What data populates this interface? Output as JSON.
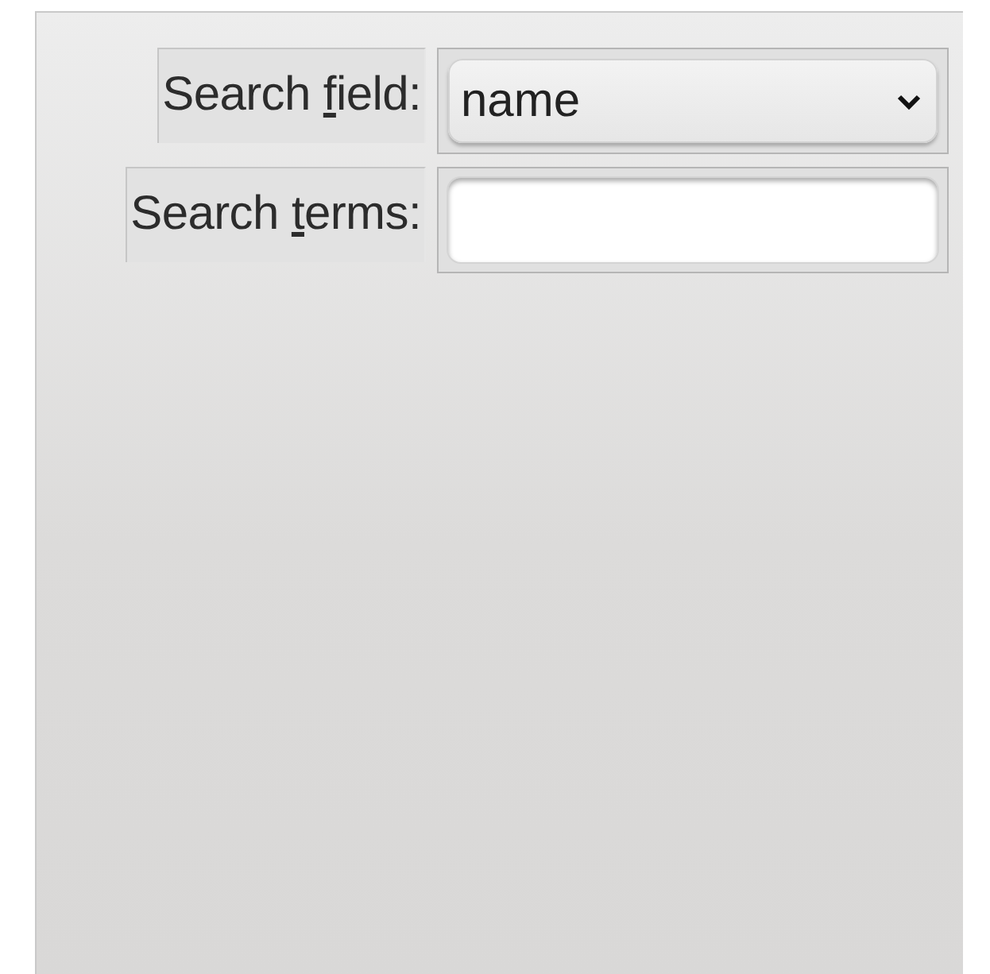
{
  "rows": [
    {
      "kind": "dropdown",
      "label": {
        "before": "Search ",
        "mnemonic": "f",
        "after": "ield:"
      },
      "value": "name"
    },
    {
      "kind": "text",
      "label": {
        "before": "Search ",
        "mnemonic": "t",
        "after": "erms:"
      },
      "value": ""
    }
  ]
}
